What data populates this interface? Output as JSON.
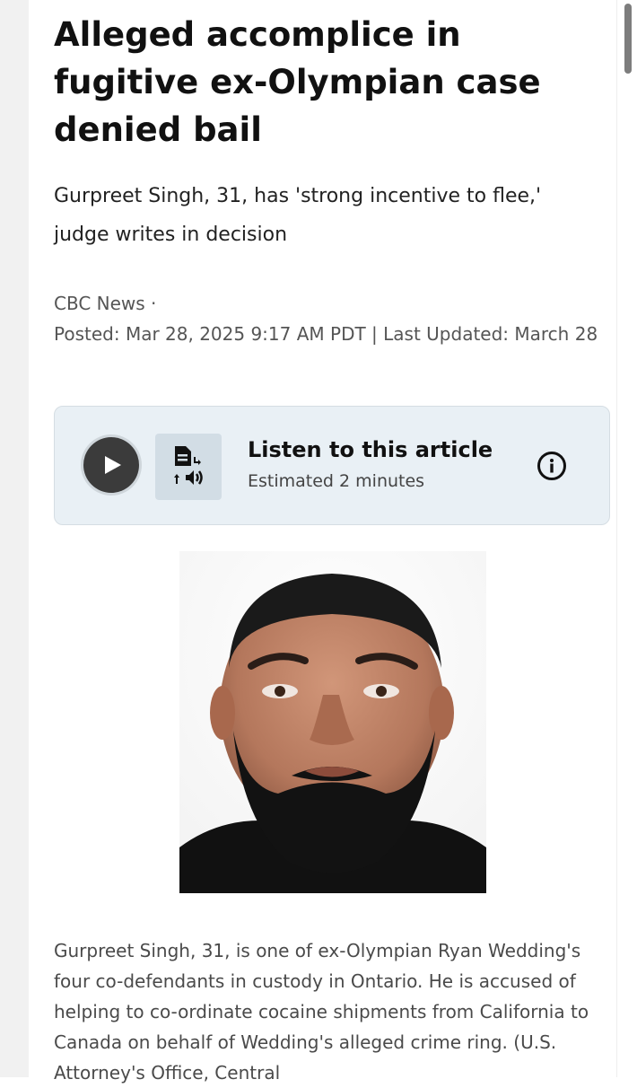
{
  "article": {
    "headline": "Alleged accomplice in fugitive ex-Olympian case denied bail",
    "deck": "Gurpreet Singh, 31, has 'strong incentive to flee,' judge writes in decision",
    "source": "CBC News ·",
    "posted": "Posted: Mar 28, 2025 9:17 AM PDT | Last Updated: March 28"
  },
  "listen": {
    "title": "Listen to this article",
    "subtitle": "Estimated 2 minutes",
    "play_icon": "play-icon",
    "tts_icon": "text-to-speech-icon",
    "info_icon": "info-icon"
  },
  "photo": {
    "subject": "portrait-photo"
  },
  "caption": {
    "text": "Gurpreet Singh, 31, is one of ex-Olympian Ryan Wedding's four co-defendants in custody in Ontario. He is accused of helping to co-ordinate cocaine shipments from California to Canada on behalf of Wedding's alleged crime ring. (U.S. Attorney's Office, Central"
  },
  "colors": {
    "card_bg": "#e9f0f5",
    "play_bg": "#3b3b3b",
    "text_primary": "#111111",
    "text_meta": "#555555"
  }
}
